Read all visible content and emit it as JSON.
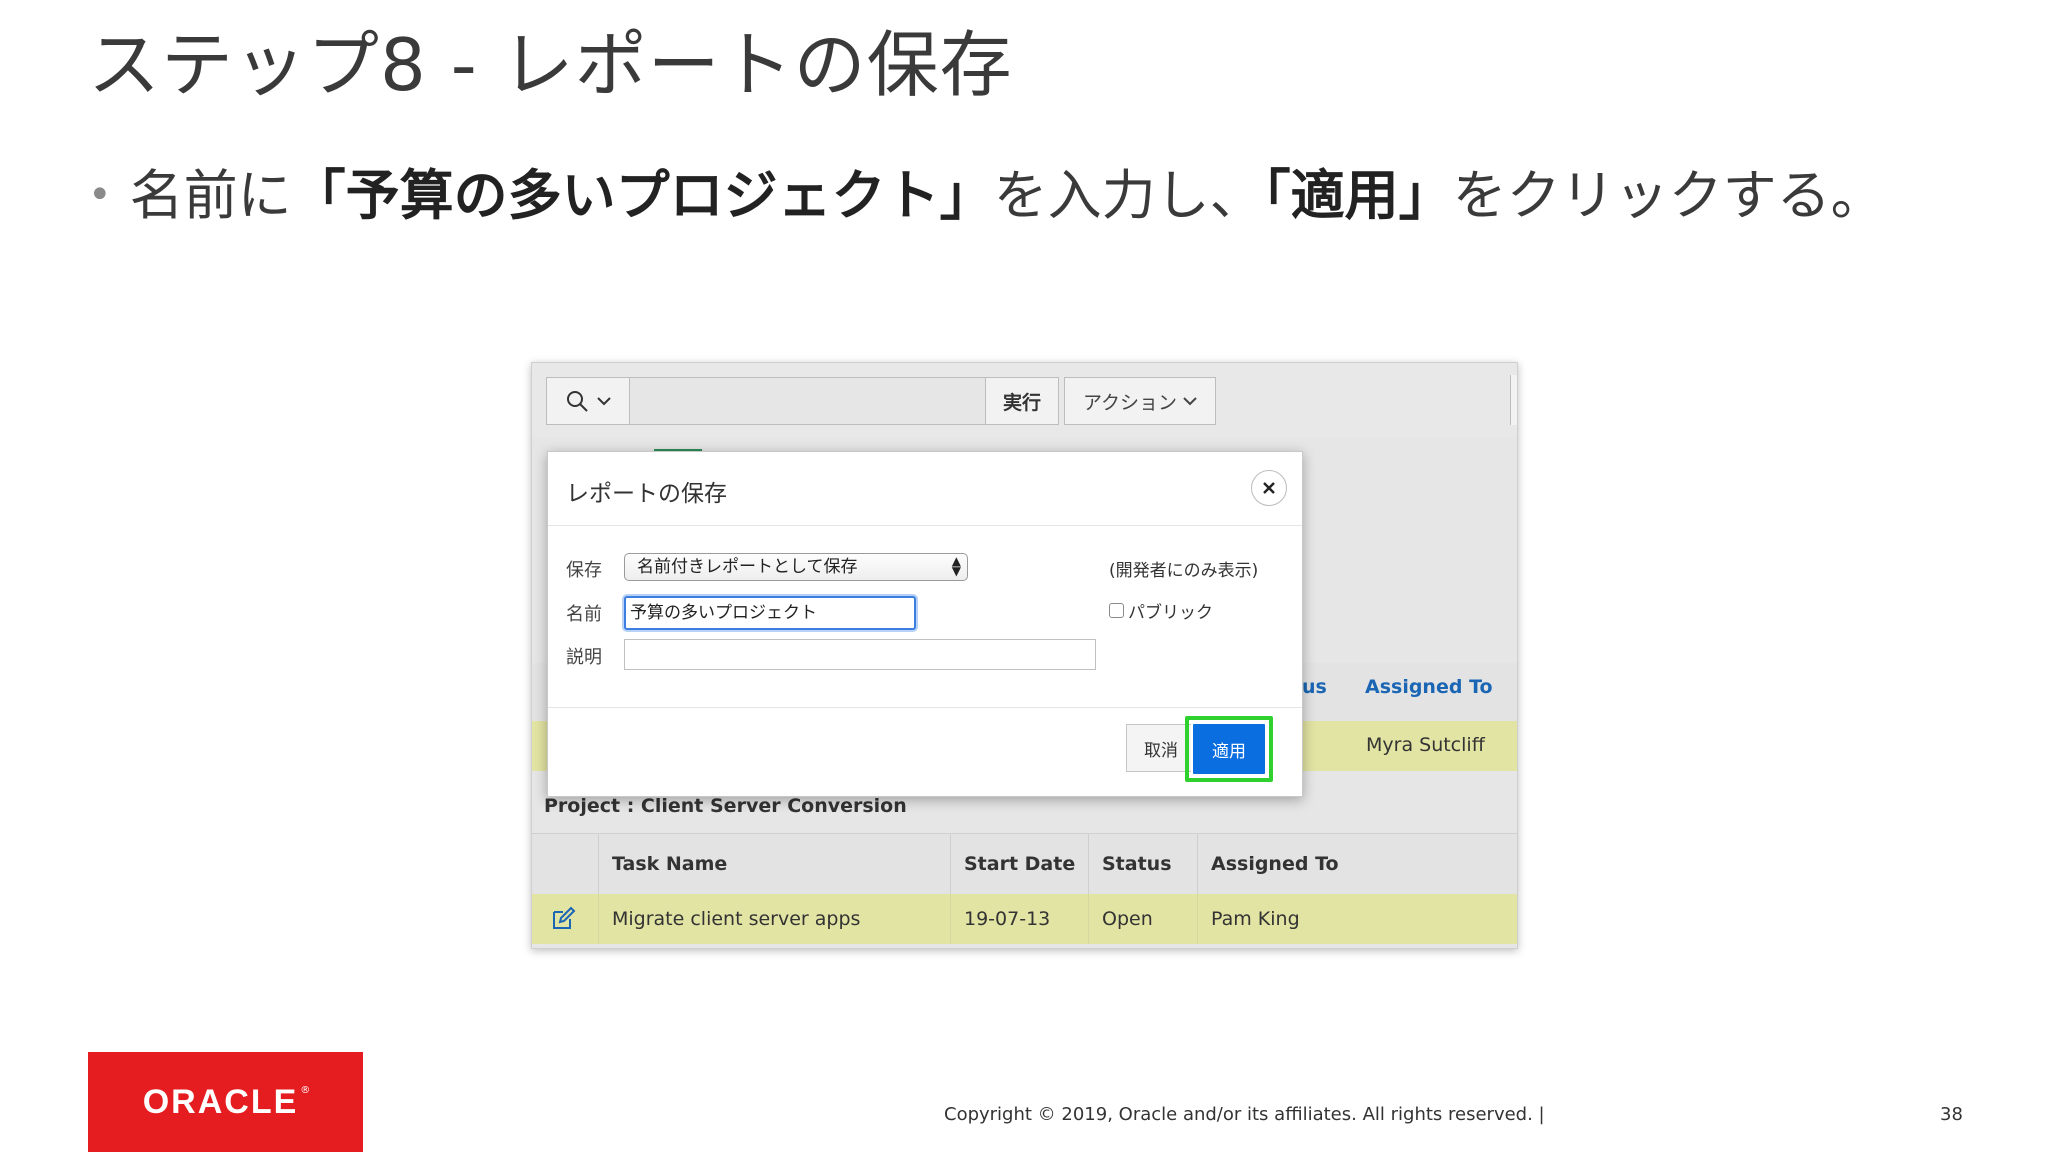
{
  "slide": {
    "title": "ステップ8 - レポートの保存",
    "bullet": {
      "prefix": "名前に",
      "name_quoted": "「予算の多いプロジェクト」",
      "middle": "を入力し、",
      "button_quoted": "「適用」",
      "suffix": "をクリックする。"
    }
  },
  "toolbar": {
    "search_icon": "magnifier-icon",
    "run_label": "実行",
    "actions_label": "アクション"
  },
  "background": {
    "status_fragment": "us",
    "assigned_to_header": "Assigned To",
    "assignee_row1": "Myra Sutcliff",
    "group_label": "Project : Client Server Conversion",
    "table": {
      "headers": [
        "Task Name",
        "Start Date",
        "Status",
        "Assigned To"
      ],
      "row": {
        "task_name": "Migrate client server apps",
        "start_date": "19-07-13",
        "status": "Open",
        "assigned_to": "Pam King"
      }
    }
  },
  "dialog": {
    "title": "レポートの保存",
    "save_label": "保存",
    "save_option": "名前付きレポートとして保存",
    "name_label": "名前",
    "name_value": "予算の多いプロジェクト",
    "description_label": "説明",
    "description_value": "",
    "dev_note": "(開発者にのみ表示)",
    "public_label": "パブリック",
    "cancel_label": "取消",
    "apply_label": "適用"
  },
  "footer": {
    "logo_text": "ORACLE",
    "copyright": "Copyright © 2019, Oracle and/or its affiliates. All rights reserved.  |",
    "page_number": "38"
  },
  "colors": {
    "apply_button": "#0a6de0",
    "highlight_box": "#2fd12f",
    "row_highlight": "#e2e4a3",
    "oracle_red": "#e51d20",
    "header_link": "#1a66b5"
  }
}
